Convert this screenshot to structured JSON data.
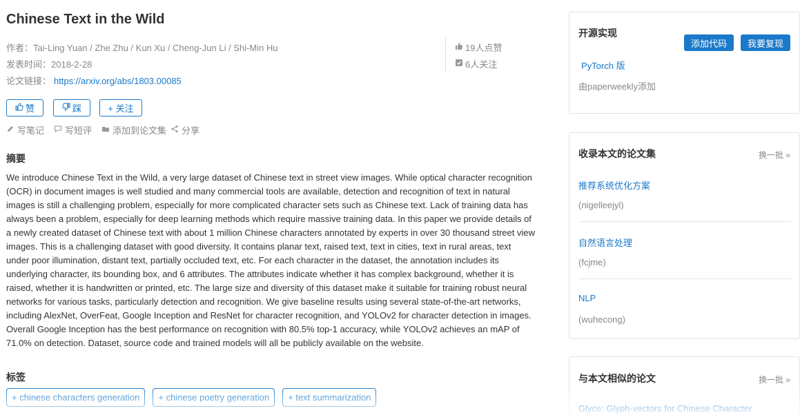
{
  "paper": {
    "title": "Chinese Text in the Wild",
    "authors_label": "作者：",
    "authors": "Tai-Ling Yuan / Zhe Zhu / Kun Xu / Cheng-Jun Li / Shi-Min Hu",
    "date_label": "发表时间：",
    "date": "2018-2-28",
    "link_label": "论文链接：",
    "link": "https://arxiv.org/abs/1803.00085",
    "likes": "19人点赞",
    "follows": "6人关注"
  },
  "buttons": {
    "like": "赞",
    "dislike": "踩",
    "follow": "+ 关注"
  },
  "actions": {
    "note": "写笔记",
    "comment": "写短评",
    "add_collection": "添加到论文集",
    "share": "分享"
  },
  "abstract": {
    "heading": "摘要",
    "text": "We introduce Chinese Text in the Wild, a very large dataset of Chinese text in street view images. While optical character recognition (OCR) in document images is well studied and many commercial tools are available, detection and recognition of text in natural images is still a challenging problem, especially for more complicated character sets such as Chinese text. Lack of training data has always been a problem, especially for deep learning methods which require massive training data. In this paper we provide details of a newly created dataset of Chinese text with about 1 million Chinese characters annotated by experts in over 30 thousand street view images. This is a challenging dataset with good diversity. It contains planar text, raised text, text in cities, text in rural areas, text under poor illumination, distant text, partially occluded text, etc. For each character in the dataset, the annotation includes its underlying character, its bounding box, and 6 attributes. The attributes indicate whether it has complex background, whether it is raised, whether it is handwritten or printed, etc. The large size and diversity of this dataset make it suitable for training robust neural networks for various tasks, particularly detection and recognition. We give baseline results using several state-of-the-art networks, including AlexNet, OverFeat, Google Inception and ResNet for character recognition, and YOLOv2 for character detection in images. Overall Google Inception has the best performance on recognition with 80.5% top-1 accuracy, while YOLOv2 achieves an mAP of 71.0% on detection. Dataset, source code and trained models will all be publicly available on the website."
  },
  "tags": {
    "heading": "标签",
    "items": [
      "+ chinese characters generation",
      "+ chinese poetry generation",
      "+ text summarization"
    ]
  },
  "sidebar": {
    "code": {
      "title": "开源实现",
      "add_code": "添加代码",
      "reproduce": "我要复现",
      "impl_link": "PyTorch 版",
      "impl_by": "由paperweekly添加"
    },
    "collections": {
      "title": "收录本文的论文集",
      "more": "换一批 »",
      "items": [
        {
          "name": "推荐系统优化方案",
          "owner": "(nigelleejyl)"
        },
        {
          "name": "自然语言处理",
          "owner": "(fcjme)"
        },
        {
          "name": "NLP",
          "owner": "(wuhecong)"
        }
      ]
    },
    "similar": {
      "title": "与本文相似的论文",
      "more": "换一批 »",
      "first": "Glyce: Glyph-vectors for Chinese Character"
    }
  },
  "colors": {
    "accent": "#1a79c9",
    "muted": "#888888",
    "border": "#e4e4e4"
  }
}
